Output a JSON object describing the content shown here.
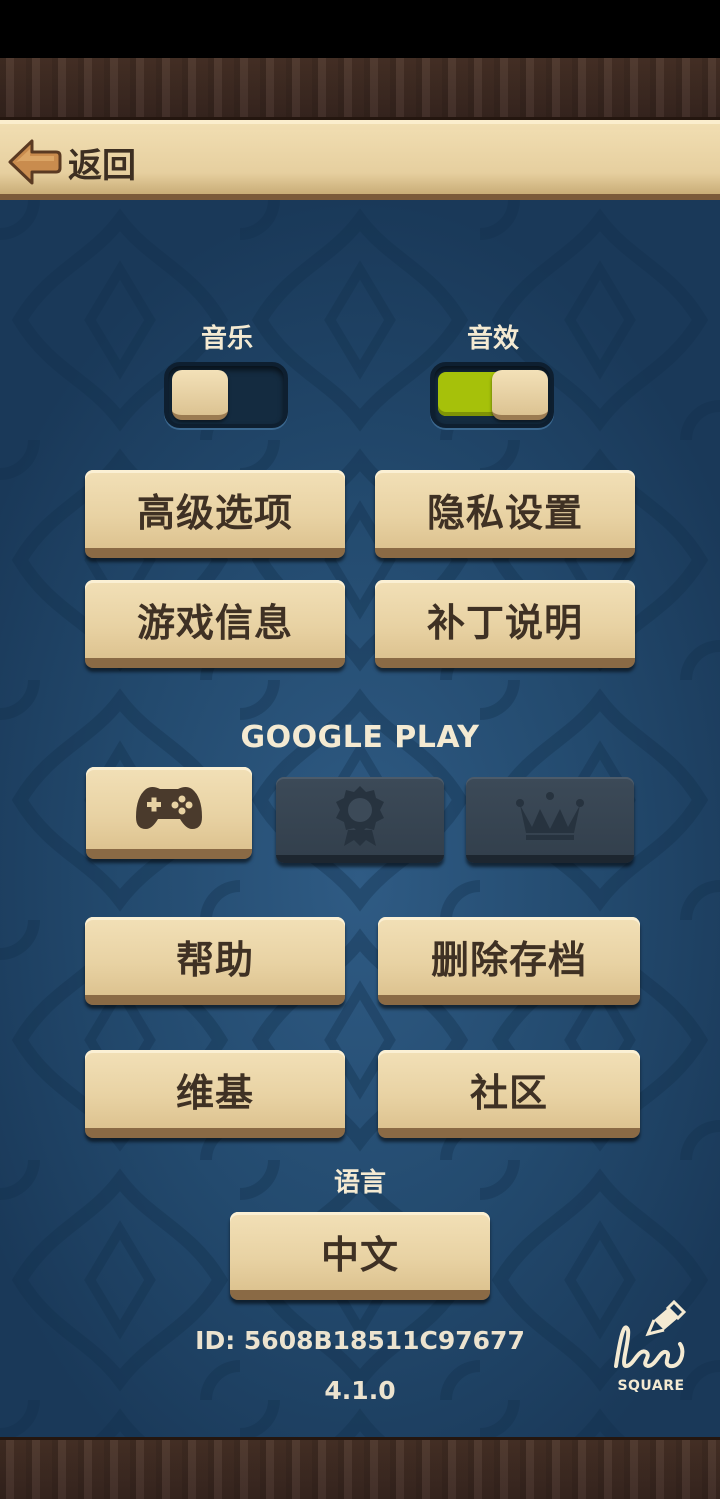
{
  "header": {
    "back_label": "返回"
  },
  "audio": {
    "music_label": "音乐",
    "music_on": false,
    "sfx_label": "音效",
    "sfx_on": true,
    "toggle_on_color": "#a6c10a"
  },
  "menu": {
    "advanced_options": "高级选项",
    "privacy_settings": "隐私设置",
    "game_info": "游戏信息",
    "patch_notes": "补丁说明"
  },
  "google_play": {
    "title": "GOOGLE PLAY",
    "buttons": [
      {
        "icon": "gamepad-icon",
        "enabled": true
      },
      {
        "icon": "achievement-icon",
        "enabled": false
      },
      {
        "icon": "leaderboard-crown-icon",
        "enabled": false
      }
    ]
  },
  "support": {
    "help": "帮助",
    "delete_save": "删除存档",
    "wiki": "维基",
    "community": "社区"
  },
  "language": {
    "title": "语言",
    "selected": "中文"
  },
  "footer": {
    "player_id": "ID: 5608B18511C97677",
    "version": "4.1.0",
    "developer_logo_text": "SQUARE",
    "developer_logo_script": "bee"
  },
  "colors": {
    "panel_blue": "#234a6e",
    "button_cream": "#e8d2a3",
    "button_text": "#3f3124",
    "wood": "#3a2720"
  }
}
